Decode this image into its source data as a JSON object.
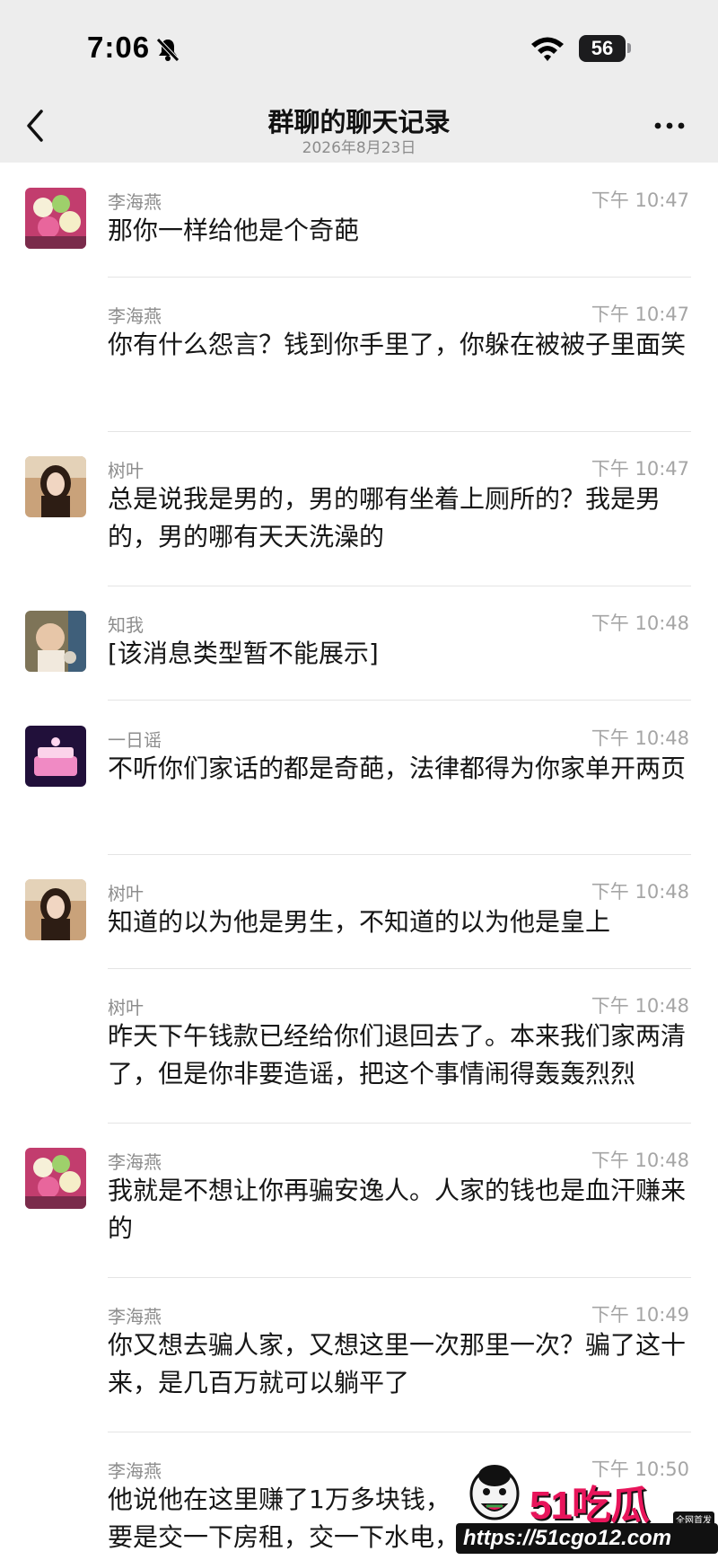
{
  "status_bar": {
    "time": "7:06",
    "battery": "56"
  },
  "header": {
    "title": "群聊的聊天记录",
    "date": "2026年8月23日"
  },
  "messages": [
    {
      "sender": "李海燕",
      "time": "下午 10:47",
      "text": "那你一样给他是个奇葩",
      "avatar": "flowers"
    },
    {
      "sender": "李海燕",
      "time": "下午 10:47",
      "text": "你有什么怨言？钱到你手里了，你躲在被被子里面笑",
      "avatar": ""
    },
    {
      "sender": "树叶",
      "time": "下午 10:47",
      "text": "总是说我是男的，男的哪有坐着上厕所的？我是男的，男的哪有天天洗澡的",
      "avatar": "woman"
    },
    {
      "sender": "知我",
      "time": "下午 10:48",
      "text": "[该消息类型暂不能展示]",
      "avatar": "child"
    },
    {
      "sender": "一日谣",
      "time": "下午 10:48",
      "text": "不听你们家话的都是奇葩，法律都得为你家单开两页",
      "avatar": "pink-cake"
    },
    {
      "sender": "树叶",
      "time": "下午 10:48",
      "text": "知道的以为他是男生，不知道的以为他是皇上",
      "avatar": "woman"
    },
    {
      "sender": "树叶",
      "time": "下午 10:48",
      "text": "昨天下午钱款已经给你们退回去了。本来我们家两清了，但是你非要造谣，把这个事情闹得轰轰烈烈",
      "avatar": ""
    },
    {
      "sender": "李海燕",
      "time": "下午 10:48",
      "text": "我就是不想让你再骗安逸人。人家的钱也是血汗赚来的",
      "avatar": "flowers"
    },
    {
      "sender": "李海燕",
      "time": "下午 10:49",
      "text": "你又想去骗人家，又想这里一次那里一次？骗了这十来，是几百万就可以躺平了",
      "avatar": ""
    },
    {
      "sender": "李海燕",
      "time": "下午 10:50",
      "text": "他说他在这里赚了1万多块钱，",
      "text2": "要是交一下房租，交一下水电，",
      "avatar": ""
    }
  ],
  "watermark": {
    "logo": "51吃瓜",
    "url": "https://51cgo12.com",
    "badge": "全网首发"
  }
}
